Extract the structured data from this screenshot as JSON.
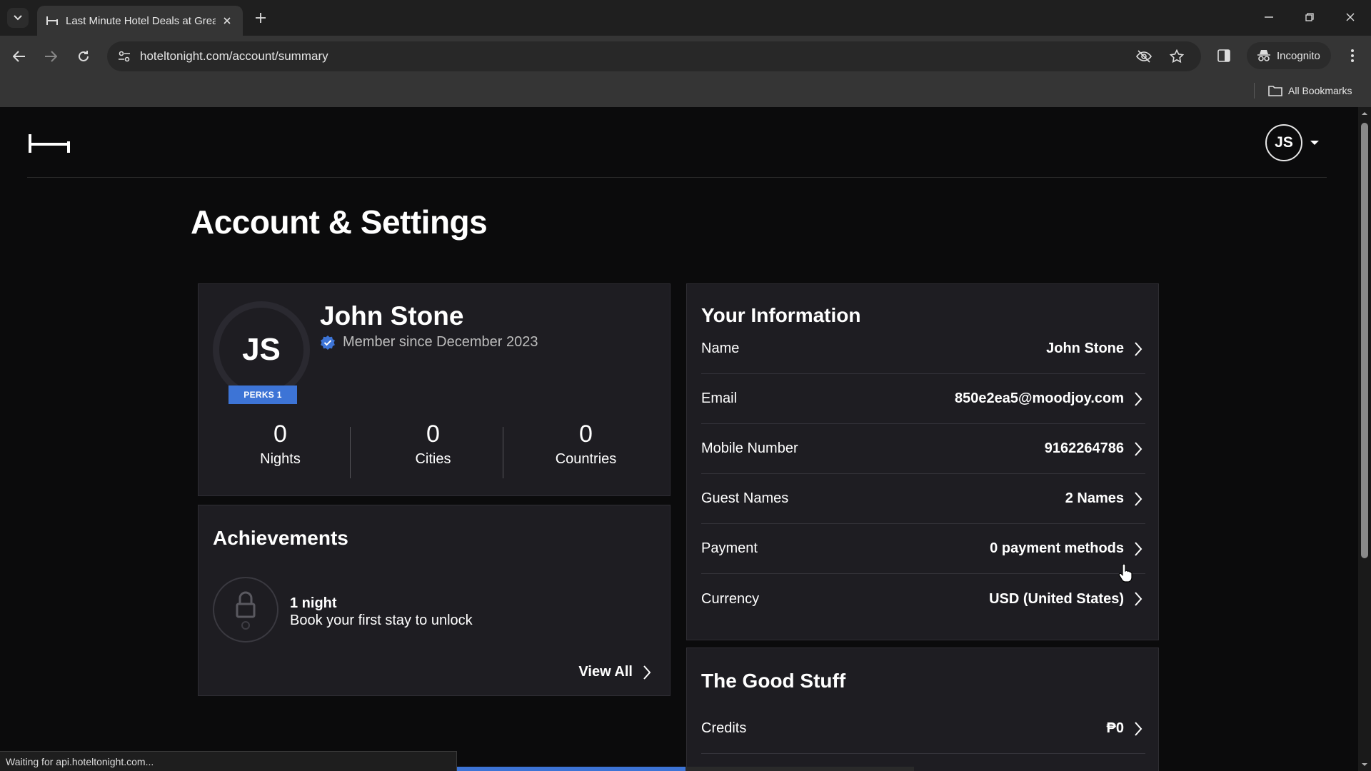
{
  "browser": {
    "tab_title": "Last Minute Hotel Deals at Great Prices",
    "url": "hoteltonight.com/account/summary",
    "incognito_label": "Incognito",
    "bookmarks_label": "All Bookmarks",
    "status_text": "Waiting for api.hoteltonight.com...",
    "load_progress": 0.5
  },
  "header": {
    "avatar_initials": "JS"
  },
  "page": {
    "title": "Account & Settings"
  },
  "profile": {
    "initials": "JS",
    "perks_badge": "PERKS 1",
    "name": "John Stone",
    "member_since": "Member since December 2023",
    "stats": [
      {
        "value": "0",
        "label": "Nights"
      },
      {
        "value": "0",
        "label": "Cities"
      },
      {
        "value": "0",
        "label": "Countries"
      }
    ]
  },
  "achievements": {
    "title": "Achievements",
    "item_name": "1 night",
    "item_desc": "Book your first stay to unlock",
    "view_all": "View All"
  },
  "your_information": {
    "title": "Your Information",
    "rows": [
      {
        "label": "Name",
        "value": "John Stone"
      },
      {
        "label": "Email",
        "value": "850e2ea5@moodjoy.com"
      },
      {
        "label": "Mobile Number",
        "value": "9162264786"
      },
      {
        "label": "Guest Names",
        "value": "2 Names"
      },
      {
        "label": "Payment",
        "value": "0 payment methods"
      },
      {
        "label": "Currency",
        "value": "USD (United States)"
      }
    ]
  },
  "good_stuff": {
    "title": "The Good Stuff",
    "rows": [
      {
        "label": "Credits",
        "value": "₱0"
      }
    ]
  },
  "colors": {
    "accent": "#3d74d6",
    "card_bg": "#1e1d22",
    "page_bg": "#0b0b0c"
  }
}
